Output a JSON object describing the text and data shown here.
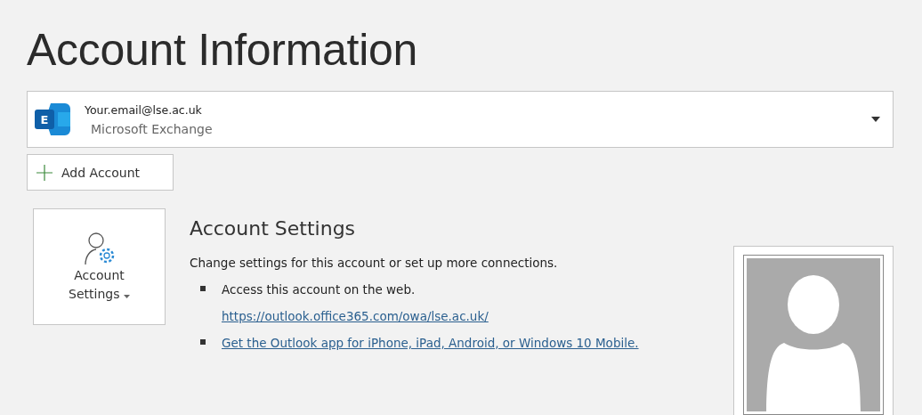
{
  "title": "Account Information",
  "account": {
    "logo_letter": "E",
    "email": "Your.email@lse.ac.uk",
    "type": "Microsoft Exchange"
  },
  "add_account": {
    "label": "Add Account"
  },
  "account_settings": {
    "button_label": "Account Settings",
    "heading": "Account Settings",
    "description": "Change settings for this account or set up more connections.",
    "items": [
      {
        "text": "Access this account on the web.",
        "link": "https://outlook.office365.com/owa/lse.ac.uk/"
      },
      {
        "link": "Get the Outlook app for iPhone, iPad, Android, or Windows 10 Mobile."
      }
    ]
  }
}
